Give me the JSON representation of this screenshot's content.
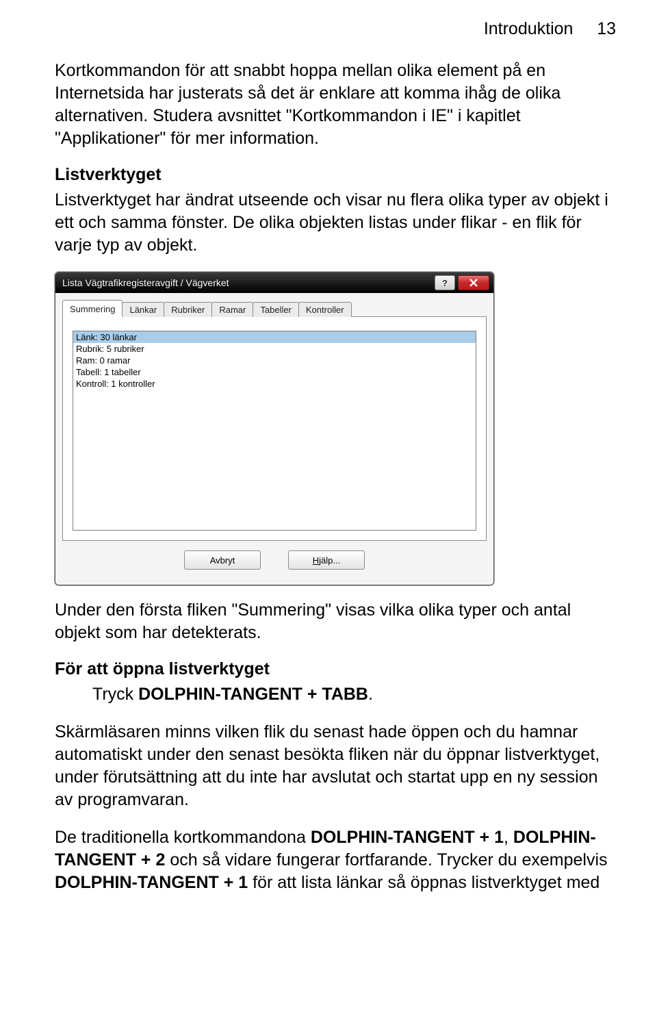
{
  "header": {
    "section": "Introduktion",
    "page_number": "13"
  },
  "intro_para": "Kortkommandon för att snabbt hoppa mellan olika element på en Internetsida har justerats så det är enklare att komma ihåg de olika alternativen. Studera avsnittet \"Kortkommandon i IE\" i kapitlet \"Applikationer\" för mer information.",
  "listverktyget_heading": "Listverktyget",
  "listverktyget_para": "Listverktyget har ändrat utseende och visar nu flera olika typer av objekt i ett och samma fönster. De olika objekten listas under flikar - en flik för varje typ av objekt.",
  "dialog": {
    "title": "Lista Vägtrafikregisteravgift / Vägverket",
    "help_btn": "?",
    "tabs": [
      "Summering",
      "Länkar",
      "Rubriker",
      "Ramar",
      "Tabeller",
      "Kontroller"
    ],
    "list_rows": [
      "Länk: 30 länkar",
      "Rubrik: 5 rubriker",
      "Ram: 0 ramar",
      "Tabell: 1 tabeller",
      "Kontroll: 1 kontroller"
    ],
    "cancel_btn": "Avbryt",
    "help_full_btn_prefix": "H",
    "help_full_btn_rest": "jälp..."
  },
  "after_para": "Under den första fliken \"Summering\" visas vilka olika typer och antal objekt som har detekterats.",
  "open_heading": "För att öppna listverktyget",
  "open_instruction_prefix": "Tryck ",
  "open_instruction_cmd": "DOLPHIN-TANGENT + TABB",
  "open_instruction_suffix": ".",
  "memory_para": "Skärmläsaren minns vilken flik du senast hade öppen och du hamnar automatiskt under den senast besökta fliken när du öppnar listverktyget, under förutsättning att du inte har avslutat och startat upp en ny session av programvaran.",
  "trad_para_p1": "De traditionella kortkommandona ",
  "trad_cmd1": "DOLPHIN-TANGENT + 1",
  "trad_para_p2": ", ",
  "trad_cmd2": "DOLPHIN-TANGENT + 2",
  "trad_para_p3": " och så vidare fungerar fortfarande. Trycker du exempelvis ",
  "trad_cmd3": "DOLPHIN-TANGENT + 1",
  "trad_para_p4": " för att lista länkar så öppnas listverktyget med"
}
